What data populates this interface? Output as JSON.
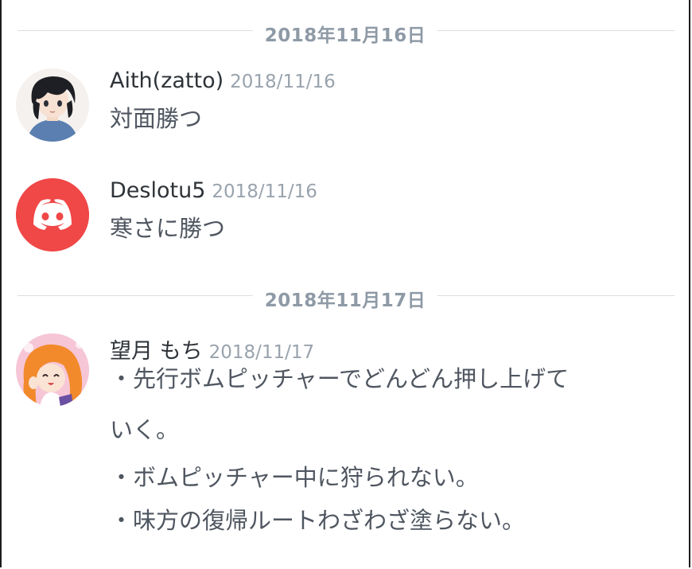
{
  "dividers": [
    {
      "date": "2018年11月16日"
    },
    {
      "date": "2018年11月17日"
    }
  ],
  "messages": [
    {
      "username": "Aith(zatto)",
      "timestamp": "2018/11/16",
      "lines": [
        "対面勝つ"
      ]
    },
    {
      "username": "Deslotu5",
      "timestamp": "2018/11/16",
      "lines": [
        "寒さに勝つ"
      ]
    },
    {
      "username": "望月 もち",
      "timestamp": "2018/11/17",
      "lines": [
        "・先行ボムピッチャーでどんどん押し上げて",
        "いく。",
        "・ボムピッチャー中に狩られない。",
        "・味方の復帰ルートわざわざ塗らない。"
      ]
    }
  ],
  "colors": {
    "discord_red": "#f04747",
    "divider_text": "#8e9aa6",
    "timestamp": "#99a3ad"
  }
}
